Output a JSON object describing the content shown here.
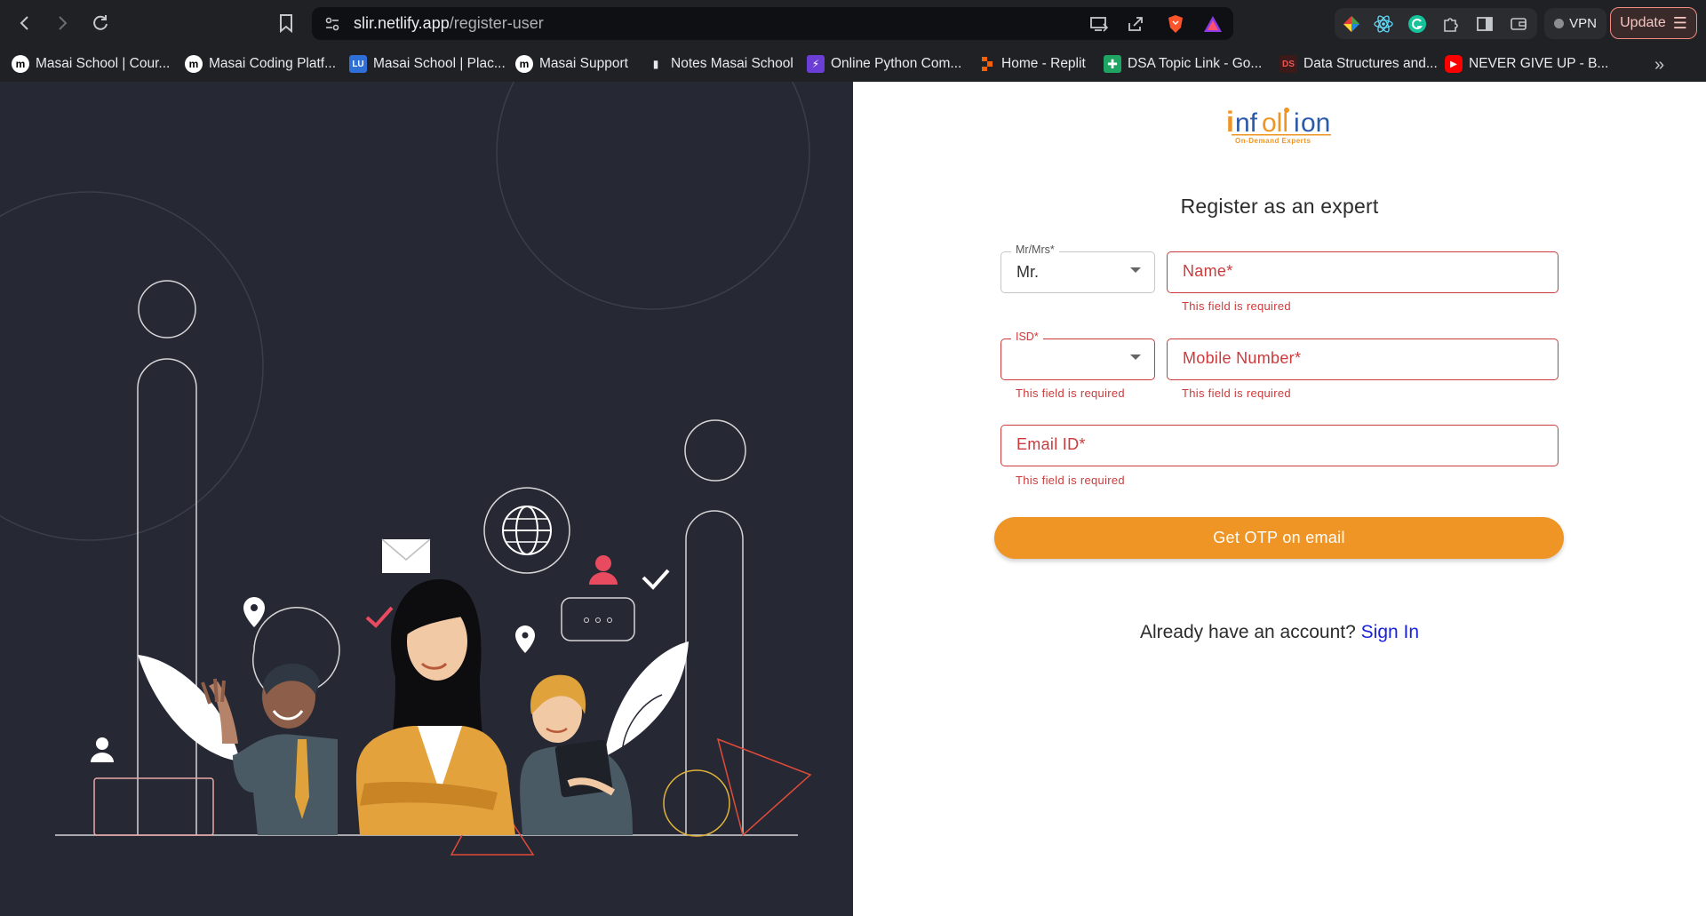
{
  "browser": {
    "url_host": "slir.netlify.app",
    "url_path": "/register-user",
    "vpn_label": "VPN",
    "update_label": "Update"
  },
  "bookmarks": [
    {
      "label": "Masai School | Cour...",
      "icon": "masai-m-icon"
    },
    {
      "label": "Masai Coding Platf...",
      "icon": "masai-m-icon"
    },
    {
      "label": "Masai School | Plac...",
      "icon": "lu-icon"
    },
    {
      "label": "Masai Support",
      "icon": "masai-m-icon"
    },
    {
      "label": "Notes Masai School",
      "icon": "notes-icon"
    },
    {
      "label": "Online Python Com...",
      "icon": "bolt-icon"
    },
    {
      "label": "Home - Replit",
      "icon": "replit-icon"
    },
    {
      "label": "DSA Topic Link - Go...",
      "icon": "sheets-icon"
    },
    {
      "label": "Data Structures and...",
      "icon": "ds-icon"
    },
    {
      "label": "NEVER GIVE UP - B...",
      "icon": "youtube-icon"
    }
  ],
  "logo": {
    "text": "infollion",
    "tagline": "On-Demand Experts"
  },
  "form": {
    "title": "Register as an expert",
    "salutation": {
      "legend": "Mr/Mrs*",
      "value": "Mr."
    },
    "name": {
      "placeholder": "Name*",
      "error": "This field is required"
    },
    "isd": {
      "legend": "ISD*",
      "value": "",
      "error": "This field is required"
    },
    "mobile": {
      "placeholder": "Mobile Number*",
      "error": "This field is required"
    },
    "email": {
      "placeholder": "Email ID*",
      "error": "This field is required"
    },
    "submit_label": "Get OTP on email",
    "signin_prompt": "Already have an account?",
    "signin_link": "Sign In"
  },
  "colors": {
    "accent": "#ee9526",
    "error": "#cc3b3b",
    "link": "#1a24d6",
    "illustration_bg": "#262834"
  }
}
